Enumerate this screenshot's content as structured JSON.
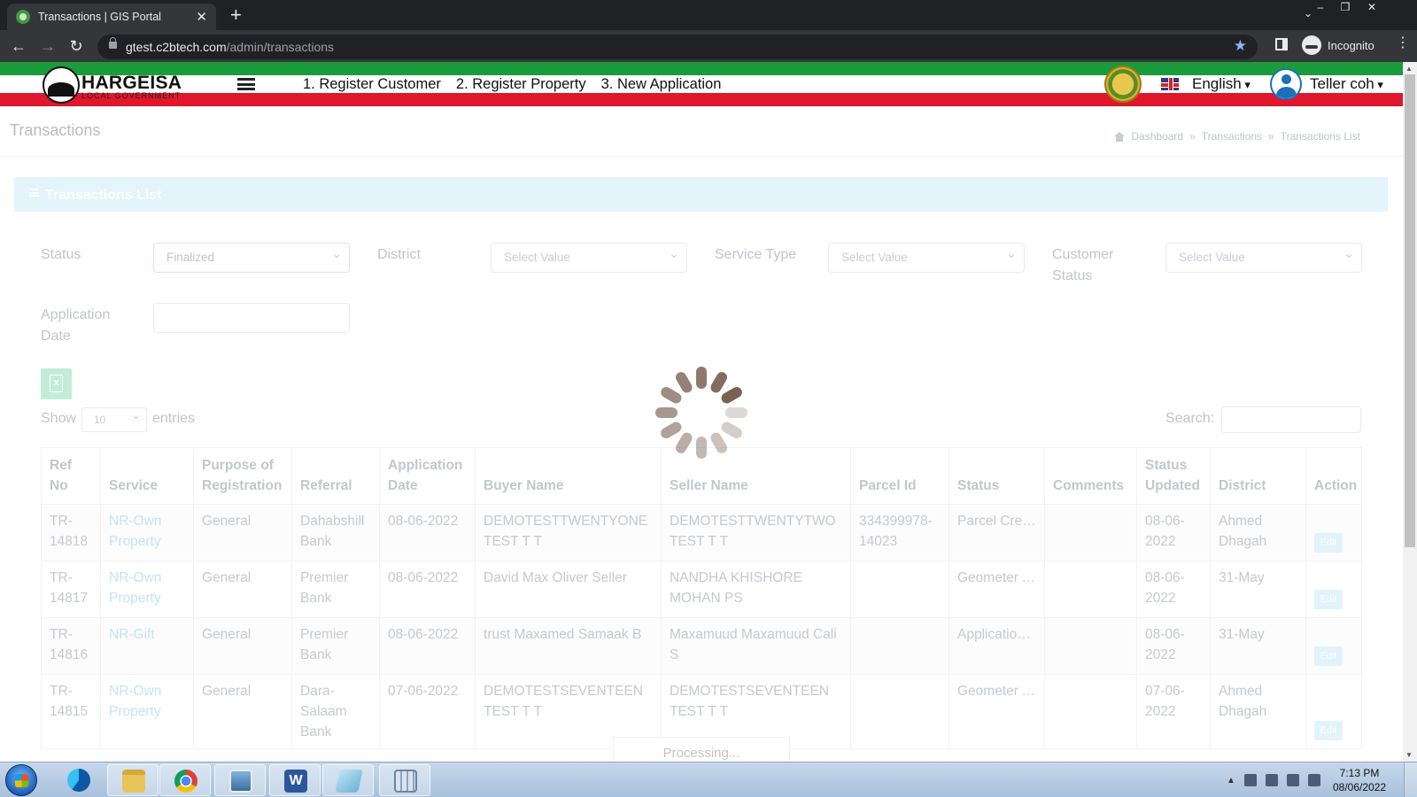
{
  "browser": {
    "tab_title": "Transactions | GIS Portal",
    "tab_close": "✕",
    "new_tab": "+",
    "url_host": "gtest.c2btech.com",
    "url_path": "/admin/transactions",
    "incognito_label": "Incognito"
  },
  "header": {
    "logo_text": "HARGEISA",
    "logo_sub": "LOCAL GOVERNMENT",
    "nav": [
      "1. Register Customer",
      "2. Register Property",
      "3. New Application"
    ],
    "language": "English",
    "user": "Teller coh"
  },
  "page": {
    "title": "Transactions",
    "breadcrumb": [
      "Dashboard",
      "»",
      "Transactions",
      "»",
      "Transactions List"
    ],
    "panel_title": "Transactions List"
  },
  "filters": {
    "status_label": "Status",
    "status_value": "Finalized",
    "district_label": "District",
    "district_value": "Select Value",
    "service_type_label": "Service Type",
    "service_type_value": "Select Value",
    "customer_status_label": "Customer Status",
    "customer_status_value": "Select Value",
    "application_date_label": "Application Date"
  },
  "table_controls": {
    "show": "Show",
    "entries_value": "10",
    "entries": "entries",
    "search": "Search:"
  },
  "table": {
    "columns": [
      "Ref No",
      "Service",
      "Purpose of Registration",
      "Referral",
      "Application Date",
      "Buyer Name",
      "Seller Name",
      "Parcel Id",
      "Status",
      "Comments",
      "Status Updated",
      "District",
      "Action"
    ],
    "rows": [
      {
        "ref": "TR-14818",
        "service": "NR-Own Property",
        "purpose": "General",
        "referral": "Dahabshill Bank",
        "app_date": "08-06-2022",
        "buyer": "DEMOTESTTWENTYONE TEST T T",
        "seller": "DEMOTESTTWENTYTWO TEST T T",
        "parcel": "334399978-14023",
        "status": "Parcel Created",
        "comments": "",
        "updated": "08-06-2022",
        "district": "Ahmed Dhagah",
        "action": "Edit"
      },
      {
        "ref": "TR-14817",
        "service": "NR-Own Property",
        "purpose": "General",
        "referral": "Premier Bank",
        "app_date": "08-06-2022",
        "buyer": "David Max Oliver Seller",
        "seller": "NANDHA KHISHORE MOHAN PS",
        "parcel": "",
        "status": "Geometer Assigned",
        "comments": "",
        "updated": "08-06-2022",
        "district": "31-May",
        "action": "Edit"
      },
      {
        "ref": "TR-14816",
        "service": "NR-Gift",
        "purpose": "General",
        "referral": "Premier Bank",
        "app_date": "08-06-2022",
        "buyer": "trust Maxamed Samaak B",
        "seller": "Maxamuud Maxamuud Cali S",
        "parcel": "",
        "status": "Application Submitted",
        "comments": "",
        "updated": "08-06-2022",
        "district": "31-May",
        "action": "Edit"
      },
      {
        "ref": "TR-14815",
        "service": "NR-Own Property",
        "purpose": "General",
        "referral": "Dara-Salaam Bank",
        "app_date": "07-06-2022",
        "buyer": "DEMOTESTSEVENTEEN TEST T T",
        "seller": "DEMOTESTSEVENTEEN TEST T T",
        "parcel": "",
        "status": "Geometer Assigned",
        "comments": "",
        "updated": "07-06-2022",
        "district": "Ahmed Dhagah",
        "action": "Edit"
      }
    ]
  },
  "processing": {
    "label": "Processing..."
  },
  "taskbar": {
    "time": "7:13 PM",
    "date": "08/06/2022"
  },
  "colors": {
    "header_green": "#1a9c3c",
    "header_red": "#e0162b",
    "link_blue": "#c3e3f7",
    "spinner": "#7a6253"
  }
}
